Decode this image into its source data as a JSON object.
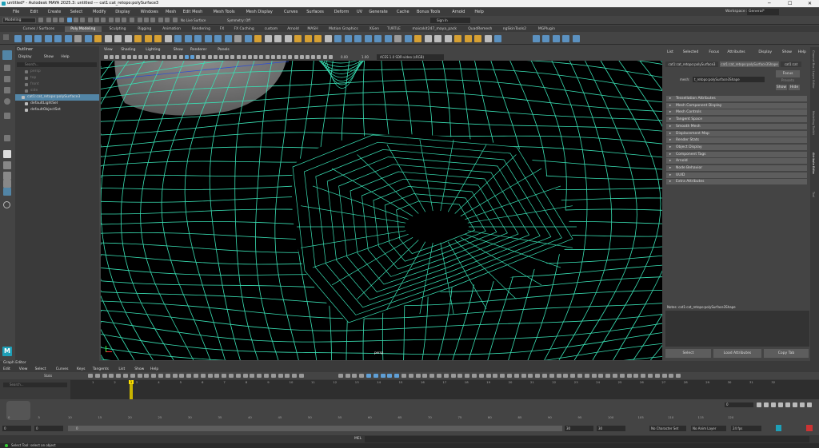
{
  "window": {
    "title": "untitled* - Autodesk MAYA 2025.3: untitled  ---  cat1:cat_retopo:polySurface3",
    "controls": [
      "─",
      "☐",
      "✕"
    ]
  },
  "menubar": {
    "items": [
      "File",
      "Edit",
      "Create",
      "Select",
      "Modify",
      "Display",
      "Windows",
      "Mesh",
      "Edit Mesh",
      "Mesh Tools",
      "Mesh Display",
      "Curves",
      "Surfaces",
      "Deform",
      "UV",
      "Generate",
      "Cache",
      "Bonus Tools",
      "Arnold",
      "Help"
    ],
    "workspace_label": "Workspace :",
    "workspace_value": "General*"
  },
  "statusline": {
    "mode": "Modeling",
    "symmetry": "Symmetry: Off",
    "live_surface": "No Live Surface",
    "sign_in": "Sign In"
  },
  "shelf": {
    "tabs": [
      "Curves / Surfaces",
      "Poly Modeling",
      "Sculpting",
      "Rigging",
      "Animation",
      "Rendering",
      "FX",
      "FX Caching",
      "custom",
      "Arnold",
      "MASH",
      "Motion Graphics",
      "XGen",
      "TURTLE",
      "maicokit247_maya_pack",
      "QuadRemesh",
      "ngSkinTools2",
      "MGPlugin"
    ],
    "active_tab": "Poly Modeling"
  },
  "outliner": {
    "title": "Outliner",
    "menu": [
      "Display",
      "Show",
      "Help"
    ],
    "search_placeholder": "Search...",
    "items": [
      {
        "label": "persp",
        "selected": false
      },
      {
        "label": "top",
        "selected": false
      },
      {
        "label": "front",
        "selected": false
      },
      {
        "label": "side",
        "selected": false
      },
      {
        "label": "cat1:cat_retopo:polySurface3",
        "selected": true
      },
      {
        "label": "defaultLightSet",
        "selected": false
      },
      {
        "label": "defaultObjectSet",
        "selected": false
      }
    ]
  },
  "viewport": {
    "menu": [
      "View",
      "Shading",
      "Lighting",
      "Show",
      "Renderer",
      "Panels"
    ],
    "camera_label": "persp",
    "field_a": "0.00",
    "field_b": "1.00",
    "color_space": "ACES 1.0 SDR-video (sRGB)"
  },
  "attribute_editor": {
    "menu": [
      "List",
      "Selected",
      "Focus",
      "Attributes",
      "Display",
      "Show",
      "Help"
    ],
    "tabs": [
      "cat1:cat_retopo:polySurface3",
      "cat1:cat_retopo:polySurface3Shape",
      "cat1:cat"
    ],
    "mesh_label": "mesh:",
    "mesh_value": "t_retopo:polySurface3Shape",
    "focus_btn": "Focus",
    "presets_btn": "Presets",
    "show_btn": "Show",
    "hide_btn": "Hide",
    "sections": [
      "Tessellation Attributes",
      "Mesh Component Display",
      "Mesh Controls",
      "Tangent Space",
      "Smooth Mesh",
      "Displacement Map",
      "Render Stats",
      "Object Display",
      "Component Tags",
      "Arnold",
      "Node Behavior",
      "UUID",
      "Extra Attributes"
    ],
    "notes_label": "Notes:  cat1:cat_retopo:polySurface3Shape",
    "bottom_buttons": [
      "Select",
      "Load Attributes",
      "Copy Tab"
    ]
  },
  "side_tabs": [
    "Channel Box / Layer Editor",
    "Modelling Toolkit",
    "Attribute Editor",
    "Tool"
  ],
  "graph_editor": {
    "title": "Graph Editor",
    "menu": [
      "Edit",
      "View",
      "Select",
      "Curves",
      "Keys",
      "Tangents",
      "List",
      "Show",
      "Help"
    ],
    "stats_label": "Stats",
    "search_placeholder": "Search...",
    "ticks": [
      "1",
      "2",
      "3",
      "4",
      "5",
      "6",
      "7",
      "8",
      "9",
      "10",
      "11",
      "12",
      "13",
      "14",
      "15",
      "16",
      "17",
      "18",
      "19",
      "20",
      "21",
      "22",
      "23",
      "24",
      "25",
      "26",
      "27",
      "28",
      "29",
      "30",
      "31",
      "32"
    ],
    "current_frame_marker": "1"
  },
  "timeline": {
    "ticks": [
      "0",
      "5",
      "10",
      "15",
      "20",
      "25",
      "30",
      "35",
      "40",
      "45",
      "50",
      "55",
      "60",
      "65",
      "70",
      "75",
      "80",
      "85",
      "90",
      "95",
      "100",
      "105",
      "110",
      "115",
      "120"
    ],
    "current_frame": "0"
  },
  "range": {
    "start": "0",
    "playback_start": "0",
    "range_label": "0",
    "playback_end": "30",
    "end": "30",
    "character_set": "No Character Set",
    "anim_layer": "No Anim Layer",
    "fps": "24 fps"
  },
  "cmdline": {
    "label": "MEL"
  },
  "helpline": {
    "text": "Select Tool: select an object"
  },
  "colors": {
    "wire": "#39e0b4",
    "selected": "#5285a6",
    "accent": "#5f9fd6",
    "shelf_active": "#5d5d5d"
  }
}
